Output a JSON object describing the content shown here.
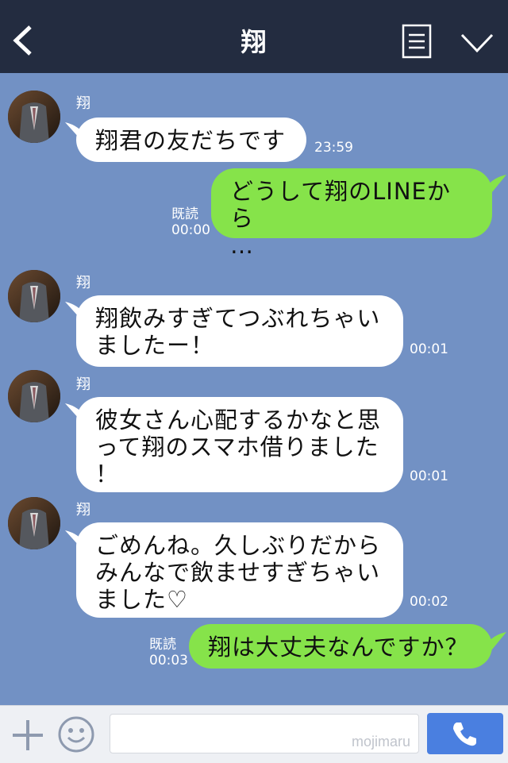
{
  "header": {
    "title": "翔"
  },
  "messages": [
    {
      "sender": "翔",
      "text": "翔君の友だちです",
      "time": "23:59"
    },
    {
      "text": "どうして翔のLINEから\n…",
      "read": "既読",
      "time": "00:00"
    },
    {
      "sender": "翔",
      "text": "翔飲みすぎてつぶれちゃい\nましたー！",
      "time": "00:01"
    },
    {
      "sender": "翔",
      "text": "彼女さん心配するかなと思\nって翔のスマホ借りました\n！",
      "time": "00:01"
    },
    {
      "sender": "翔",
      "text": "ごめんね。久しぶりだから\nみんなで飲ませすぎちゃい\nました♡",
      "time": "00:02"
    },
    {
      "text": "翔は大丈夫なんですか？",
      "read": "既読",
      "time": "00:03"
    }
  ],
  "footer": {
    "input_value": "mojimaru"
  },
  "colors": {
    "header": "#232c40",
    "background": "#7291c4",
    "incoming": "#ffffff",
    "outgoing": "#86e34a",
    "send": "#4a7fe0"
  }
}
